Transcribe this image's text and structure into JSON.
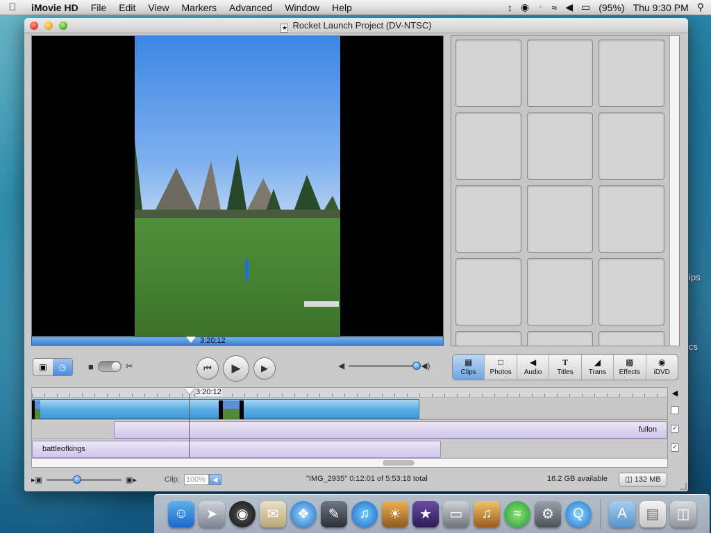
{
  "menubar": {
    "app_name": "iMovie HD",
    "menus": [
      "File",
      "Edit",
      "View",
      "Markers",
      "Advanced",
      "Window",
      "Help"
    ],
    "battery": "(95%)",
    "clock": "Thu 9:30 PM"
  },
  "desktop": {
    "label_1": "ips",
    "label_2": "cs"
  },
  "window": {
    "title": "Rocket Launch Project (DV-NTSC)"
  },
  "viewer": {
    "scrub_time": "3:20:12"
  },
  "panes": {
    "buttons": [
      {
        "label": "Clips",
        "icon": "clips-icon",
        "active": true
      },
      {
        "label": "Photos",
        "icon": "photos-icon"
      },
      {
        "label": "Audio",
        "icon": "audio-icon"
      },
      {
        "label": "Titles",
        "icon": "titles-icon"
      },
      {
        "label": "Trans",
        "icon": "transitions-icon"
      },
      {
        "label": "Effects",
        "icon": "effects-icon"
      },
      {
        "label": "iDVD",
        "icon": "idvd-icon"
      }
    ]
  },
  "timeline": {
    "playhead_time": "3:20:12",
    "audio_track_1": "fullon",
    "audio_track_2": "battleofkings"
  },
  "status": {
    "clip_label": "Clip:",
    "clip_volume": "100%",
    "clip_info": "\"IMG_2935\"  0:12:01 of 5:53:18 total",
    "available": "16.2 GB available",
    "trash": "132 MB"
  },
  "dock": {
    "apps": [
      "finder",
      "launchpad",
      "dashboard",
      "mail",
      "safari",
      "itunes-font",
      "itunes",
      "iphoto",
      "imovie",
      "keynote",
      "garageband",
      "spotify",
      "system-preferences",
      "quicktime",
      "applications-folder",
      "documents",
      "trash"
    ]
  }
}
